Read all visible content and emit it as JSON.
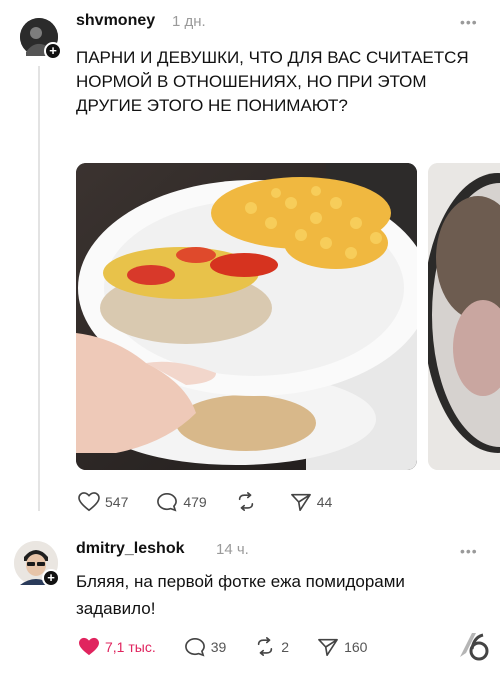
{
  "post": {
    "username": "shvmoney",
    "time": "1 дн.",
    "more": "•••",
    "text": "ПАРНИ И ДЕВУШКИ, ЧТО ДЛЯ ВАС СЧИТАЕТСЯ НОРМОЙ В ОТНОШЕНИЯХ, НО ПРИ ЭТОМ ДРУГИЕ ЭТОГО НЕ ПОНИМАЮТ?",
    "likes": "547",
    "comments": "479",
    "reposts": "",
    "shares": "44"
  },
  "comment": {
    "username": "dmitry_leshok",
    "time": "14 ч.",
    "more": "•••",
    "text": "Бляяя, на первой фотке ежа помидорами задавило!",
    "likes": "7,1 тыс.",
    "comments": "39",
    "reposts": "2",
    "shares": "160"
  },
  "colors": {
    "like_active": "#e0245e",
    "muted": "#9a9a9a",
    "text": "#111111"
  },
  "icons": [
    "plus-icon",
    "heart-icon",
    "comment-icon",
    "repost-icon",
    "share-icon",
    "more-icon"
  ]
}
